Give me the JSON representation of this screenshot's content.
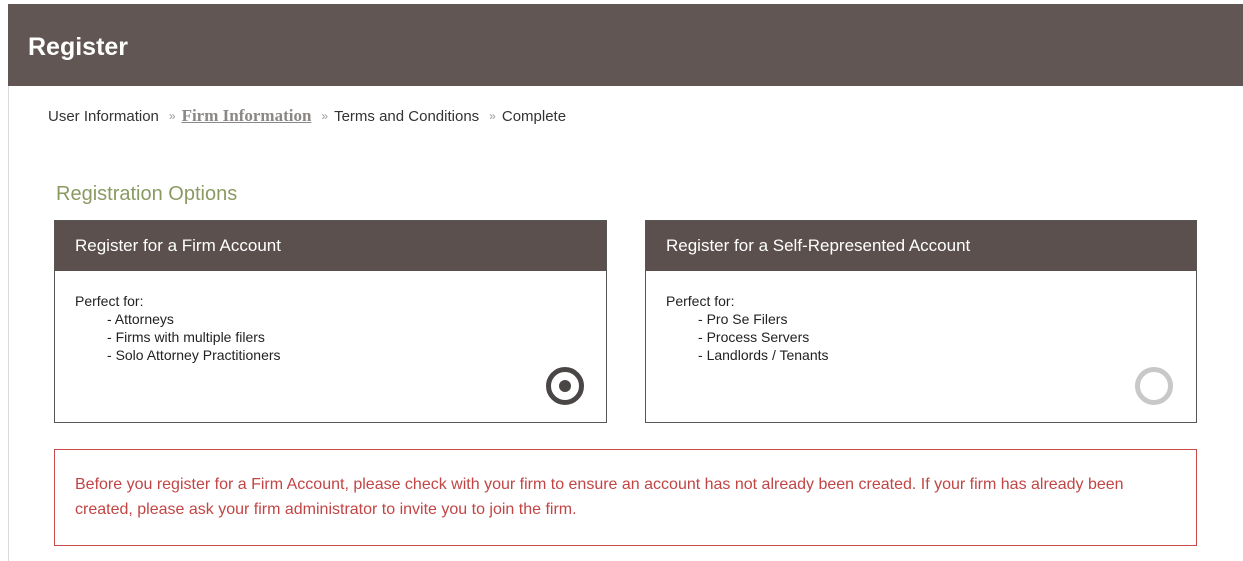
{
  "header": {
    "title": "Register"
  },
  "breadcrumb": {
    "steps": [
      {
        "label": "User Information"
      },
      {
        "label": "Firm Information"
      },
      {
        "label": "Terms and Conditions"
      },
      {
        "label": "Complete"
      }
    ],
    "separator": "»",
    "active_step": 1
  },
  "options": {
    "title": "Registration Options",
    "cards": [
      {
        "title": "Register for a Firm Account",
        "intro": "Perfect for:",
        "items": [
          "Attorneys",
          "Firms with multiple filers",
          "Solo Attorney Practitioners"
        ],
        "selected": true
      },
      {
        "title": "Register for a Self-Represented Account",
        "intro": "Perfect for:",
        "items": [
          "Pro Se Filers",
          "Process Servers",
          "Landlords / Tenants"
        ],
        "selected": false
      }
    ]
  },
  "notice": {
    "text": "Before you register for a Firm Account, please check with your firm to ensure an account has not already been created. If your firm has already been created, please ask your firm administrator to invite you to join the firm."
  },
  "colors": {
    "header_bg": "#615654",
    "card_header_bg": "#5b504e",
    "section_title": "#8b9a63",
    "notice_text": "#c24545",
    "notice_border": "#c94a4a",
    "active_step": "#8a8785"
  },
  "icons": {
    "selected_radio": "radio-selected-icon",
    "unselected_radio": "radio-unselected-icon"
  }
}
